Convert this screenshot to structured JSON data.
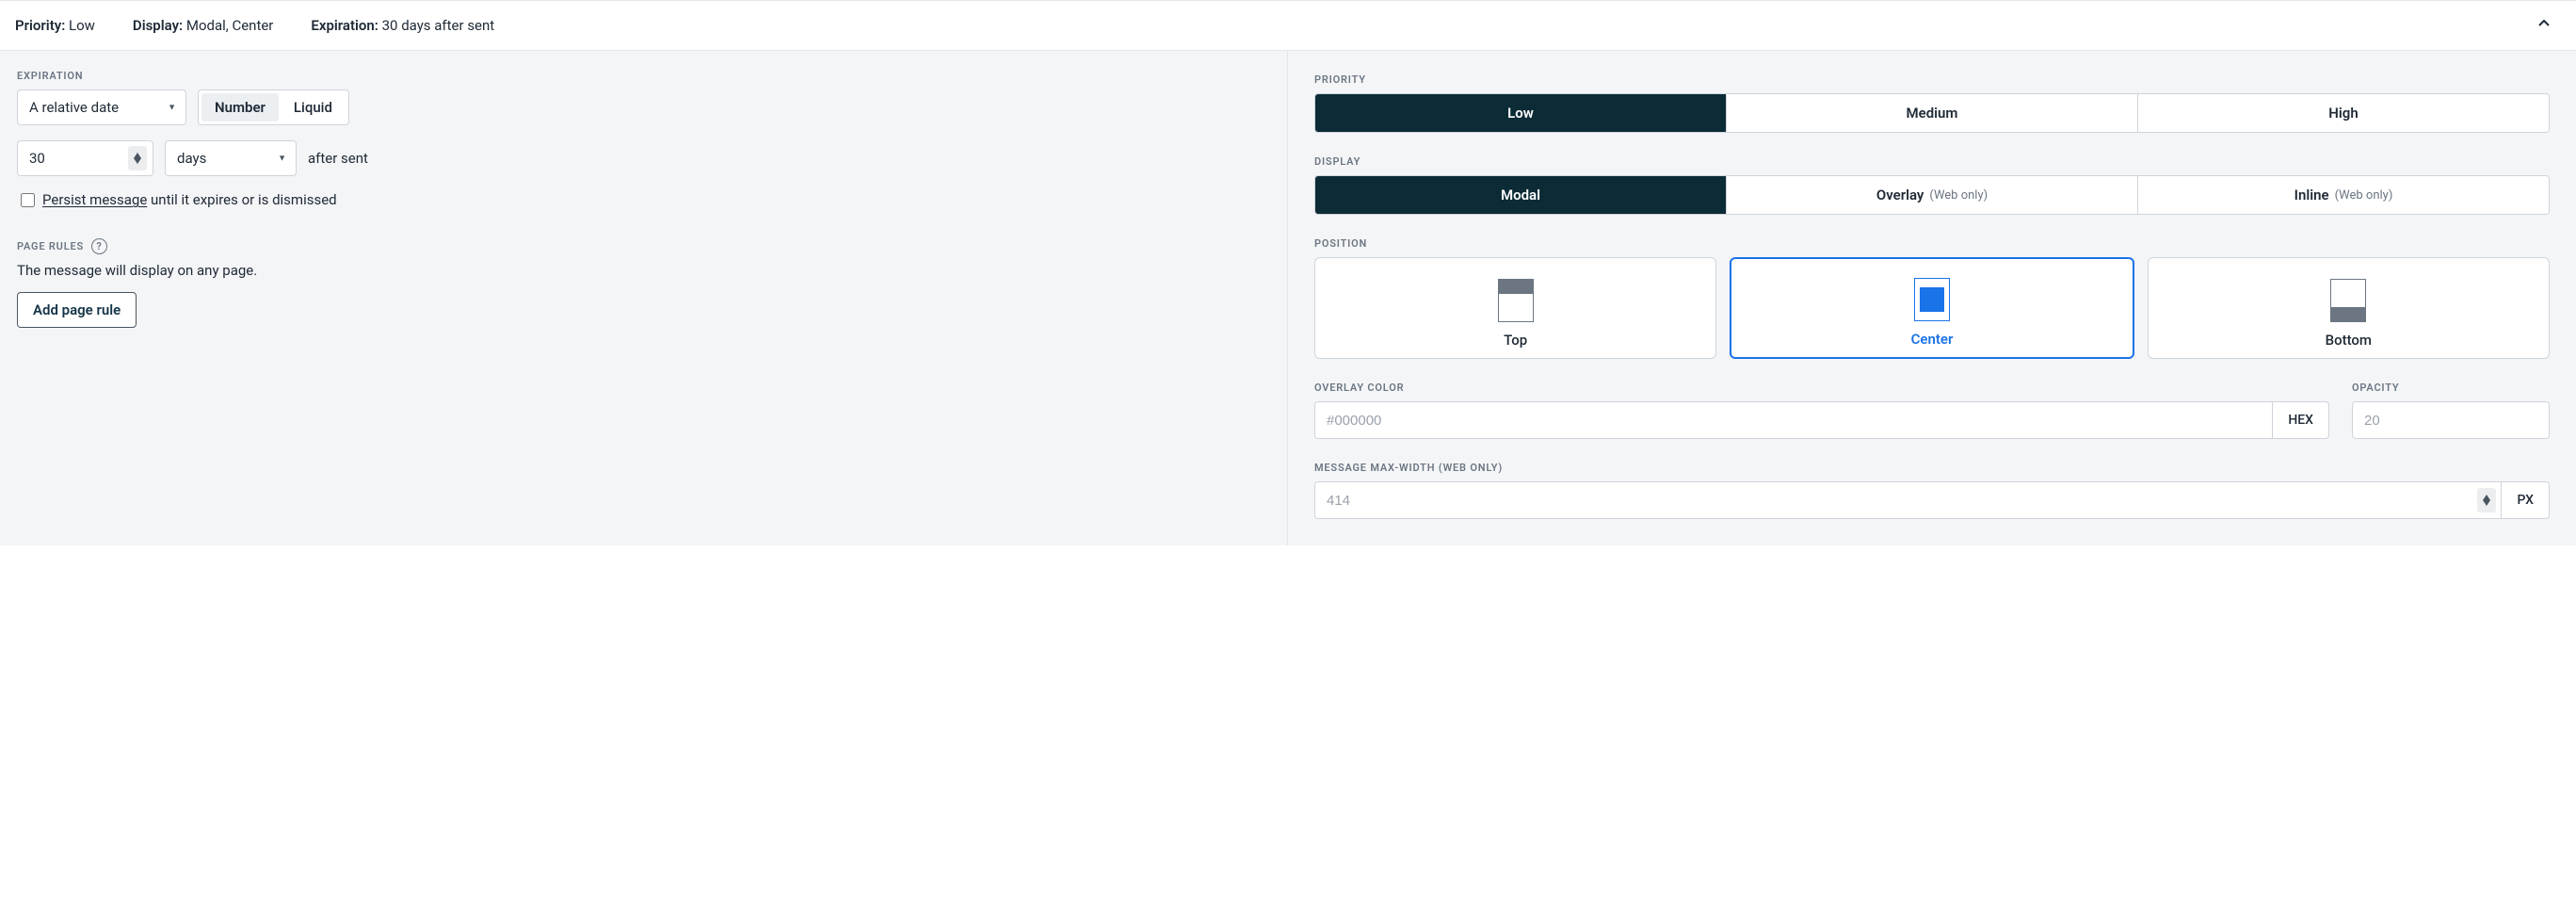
{
  "header": {
    "priority_label": "Priority:",
    "priority_value": "Low",
    "display_label": "Display:",
    "display_value": "Modal, Center",
    "expiration_label": "Expiration:",
    "expiration_value": "30 days after sent"
  },
  "left": {
    "expiration_heading": "EXPIRATION",
    "date_type": "A relative date",
    "segment_number": "Number",
    "segment_liquid": "Liquid",
    "number_value": "30",
    "unit_value": "days",
    "after_sent": "after sent",
    "persist_underlined": "Persist message",
    "persist_rest": " until it expires or is dismissed",
    "page_rules_heading": "PAGE RULES",
    "page_rules_text": "The message will display on any page.",
    "add_page_rule": "Add page rule"
  },
  "right": {
    "priority_heading": "PRIORITY",
    "priority_options": {
      "low": "Low",
      "medium": "Medium",
      "high": "High"
    },
    "display_heading": "DISPLAY",
    "display_options": {
      "modal": "Modal",
      "overlay": "Overlay",
      "inline": "Inline",
      "web_only": "(Web only)"
    },
    "position_heading": "POSITION",
    "position": {
      "top": "Top",
      "center": "Center",
      "bottom": "Bottom"
    },
    "overlay_color_heading": "OVERLAY COLOR",
    "overlay_color_placeholder": "#000000",
    "hex_label": "HEX",
    "opacity_heading": "OPACITY",
    "opacity_placeholder": "20",
    "percent_label": "%",
    "max_width_heading": "MESSAGE MAX-WIDTH (WEB ONLY)",
    "max_width_placeholder": "414",
    "px_label": "PX"
  }
}
